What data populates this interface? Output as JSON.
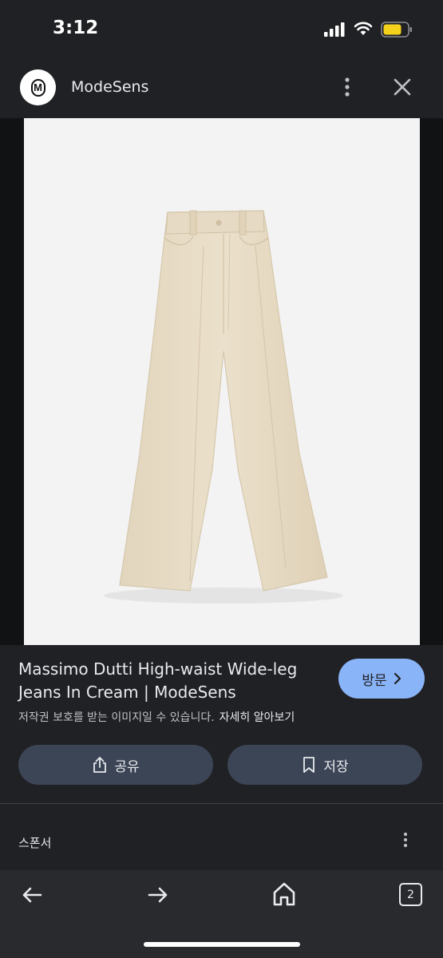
{
  "status_bar": {
    "time": "3:12",
    "battery_color": "#f4d21b"
  },
  "header": {
    "site_logo_letter": "M",
    "site_name": "ModeSens",
    "icons": [
      "more-vert-icon",
      "close-icon"
    ]
  },
  "image": {
    "subject": "cream wide-leg jeans product photo",
    "background_color": "#f3f3f3",
    "product_color": "#e8dcc6"
  },
  "result": {
    "title": "Massimo Dutti High-waist Wide-leg Jeans In Cream | ModeSens",
    "copyright_notice": "저작권 보호를 받는 이미지일 수 있습니다.",
    "learn_more_link": "자세히 알아보기",
    "visit_button": "방문",
    "share_button": "공유",
    "save_button": "저장"
  },
  "sponsor": {
    "label": "스폰서"
  },
  "bottom_nav": {
    "tab_count": "2",
    "icons": [
      "back-arrow-icon",
      "forward-arrow-icon",
      "home-icon",
      "tabs-icon"
    ]
  },
  "colors": {
    "background": "#202124",
    "accent": "#8ab4f8",
    "button_bg": "#3c4556",
    "nav_bg": "#292a2d"
  }
}
